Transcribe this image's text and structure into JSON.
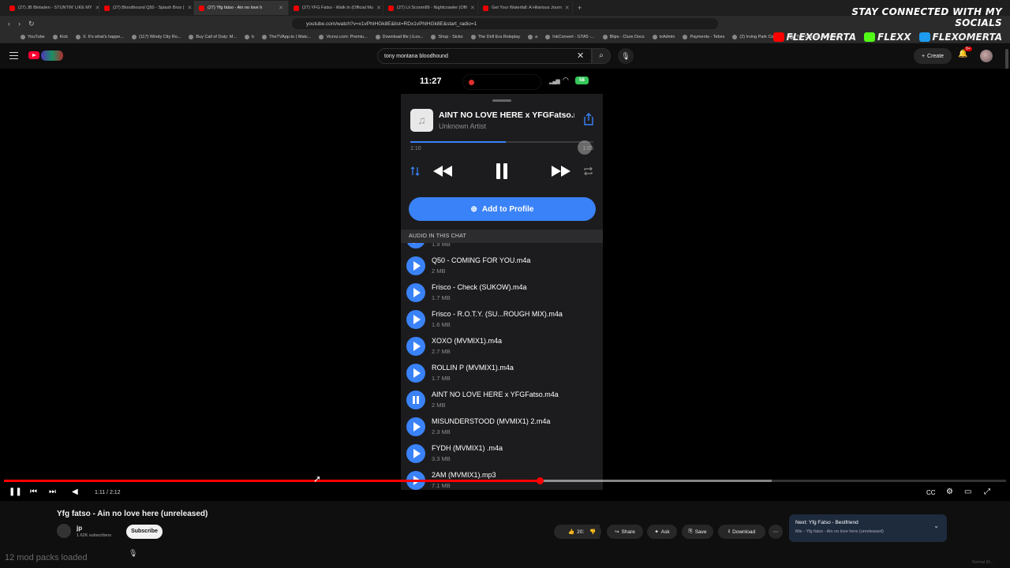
{
  "browser": {
    "tabs": [
      {
        "label": "(27) JB Binladen - STUNTIN' LIKE MY"
      },
      {
        "label": "(27) Bloodhound Q50 - Splash Bros ("
      },
      {
        "label": "(27) Yfg fatso - Ain no love h"
      },
      {
        "label": "(27) YFG Fatso - Walk In (Official Mu"
      },
      {
        "label": "(27) Lil Scoom89 - Nightcrawler (Offi"
      },
      {
        "label": "Get Your Waterfall: A Hilarious Journ"
      }
    ],
    "url": "youtube.com/watch?v=x1vPhIHGk8E&list=RDx1vPhIHGk8E&start_radio=1",
    "bookmarks": [
      "YouTube",
      "Kick",
      "X. It's what's happe...",
      "(117) Windy City Ro...",
      "Buy Call of Duty: M...",
      "b",
      "TheTVApp.to | Watc...",
      "Vicrez.com: Premiu...",
      "Download file | iLov...",
      "Shop - Sicko",
      "The Drill Era Roleplay",
      "a",
      "InkConvert - GTA5 -...",
      "Blips - Clure Docs",
      "txAdmin",
      "Payments - Tebex",
      "(2) Irving Park Com...",
      "The Drill Era Roleplay"
    ]
  },
  "overlay": {
    "title": "STAY CONNECTED WITH MY SOCIALS",
    "socials": [
      {
        "name": "FLEXOMERTA",
        "color": "#ff0000"
      },
      {
        "name": "FLEXX",
        "color": "#53fc18"
      },
      {
        "name": "FLEXOMERTA",
        "color": "#1d9bf0"
      }
    ]
  },
  "youtube": {
    "search_value": "tony montana bloodhound",
    "create_label": "Create",
    "notif_count": "9+"
  },
  "phone": {
    "time": "11:27",
    "battery": "58",
    "now_playing": {
      "title": "AINT NO LOVE HERE x YFGFatso.m4a",
      "artist": "Unknown Artist",
      "elapsed": "1:10",
      "remaining": "1:05",
      "progress": 0.52
    },
    "add_profile_label": "Add to Profile",
    "audio_header": "AUDIO IN THIS CHAT",
    "files": [
      {
        "name": "",
        "size": "1.9 MB",
        "playing": false
      },
      {
        "name": "Q50 - COMING FOR YOU.m4a",
        "size": "2 MB",
        "playing": false
      },
      {
        "name": "Frisco - Check (SUKOW).m4a",
        "size": "1.7 MB",
        "playing": false
      },
      {
        "name": "Frisco - R.O.T.Y. (SU...ROUGH MIX).m4a",
        "size": "1.6 MB",
        "playing": false
      },
      {
        "name": "XOXO (MVMIX1).m4a",
        "size": "2.7 MB",
        "playing": false
      },
      {
        "name": "ROLLIN P (MVMIX1).m4a",
        "size": "1.7 MB",
        "playing": false
      },
      {
        "name": "AINT NO LOVE HERE x YFGFatso.m4a",
        "size": "2 MB",
        "playing": true
      },
      {
        "name": "MISUNDERSTOOD (MVMIX1) 2.m4a",
        "size": "2.3 MB",
        "playing": false
      },
      {
        "name": "FYDH (MVMIX1) .m4a",
        "size": "3.3 MB",
        "playing": false
      },
      {
        "name": "2AM (MVMIX1).mp3",
        "size": "7.1 MB",
        "playing": false
      }
    ]
  },
  "player": {
    "timecode": "1:11 / 2:12",
    "played": 0.535,
    "buffered": 0.766
  },
  "video": {
    "title": "Yfg fatso - Ain no love here (unreleased)",
    "channel": "jp",
    "subscribers": "1.62K subscribers",
    "subscribe_label": "Subscribe",
    "likes": "201",
    "share_label": "Share",
    "ask_label": "Ask",
    "save_label": "Save",
    "download_label": "Download"
  },
  "up_next": {
    "title": "Next: Yfg Fatso - Bestfriend",
    "subtitle": "Mix - Yfg fatso - Ain no love here (unreleased)"
  },
  "footer": {
    "mods": "12 mod packs loaded",
    "corner": "Normal (R..."
  }
}
